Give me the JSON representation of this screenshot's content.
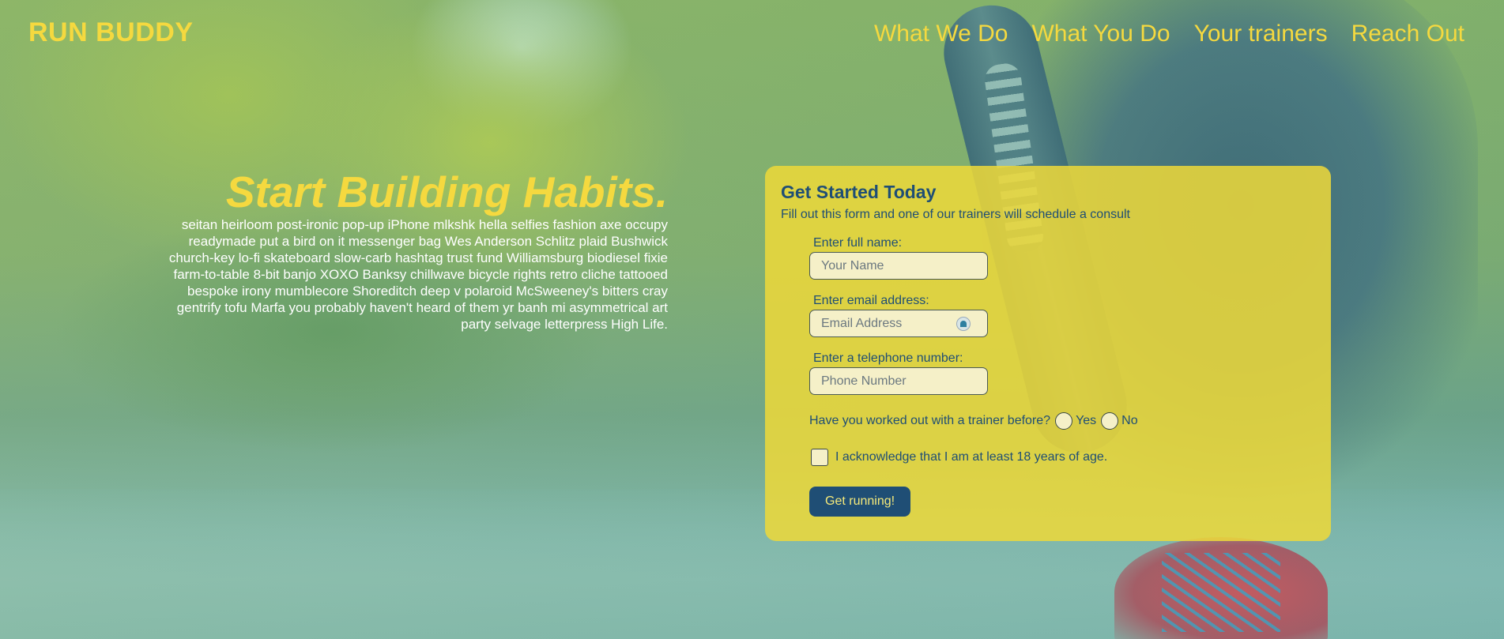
{
  "header": {
    "logo": "RUN BUDDY",
    "nav": [
      "What We Do",
      "What You Do",
      "Your trainers",
      "Reach Out"
    ]
  },
  "intro": {
    "title": "Start Building Habits.",
    "body": "seitan heirloom post-ironic pop-up iPhone mlkshk hella selfies fashion axe occupy readymade put a bird on it messenger bag Wes Anderson Schlitz plaid Bushwick church-key lo-fi skateboard slow-carb hashtag trust fund Williamsburg biodiesel fixie farm-to-table 8-bit banjo XOXO Banksy chillwave bicycle rights retro cliche tattooed bespoke irony mumblecore Shoreditch deep v polaroid McSweeney's bitters cray gentrify tofu Marfa you probably haven't heard of them yr banh mi asymmetrical art party selvage letterpress High Life."
  },
  "form": {
    "title": "Get Started Today",
    "subtitle": "Fill out this form and one of our trainers will schedule a consult",
    "name_label": "Enter full name:",
    "name_placeholder": "Your Name",
    "email_label": "Enter email address:",
    "email_placeholder": "Email Address",
    "phone_label": "Enter a telephone number:",
    "phone_placeholder": "Phone Number",
    "trainer_question": "Have you worked out with a trainer before?",
    "yes_label": "Yes",
    "no_label": "No",
    "age_ack": "I acknowledge that I am at least 18 years of age.",
    "submit_label": "Get running!"
  },
  "colors": {
    "accent_yellow": "#f5d93f",
    "card_yellow": "#eed939",
    "navy": "#1f4e75"
  }
}
